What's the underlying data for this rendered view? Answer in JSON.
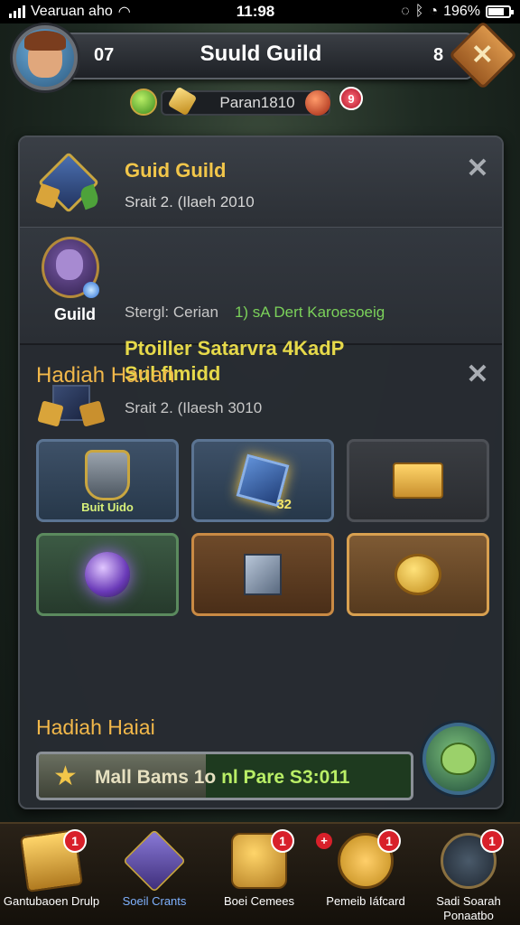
{
  "status_bar": {
    "carrier": "Vearuan aho",
    "time": "11:98",
    "battery": "196%"
  },
  "header": {
    "level": "07",
    "title": "Suuld Guild",
    "count": "8",
    "close_symbol": "✕",
    "currency_label": "Paran1810",
    "notification_badge": "9"
  },
  "guild_card": {
    "title": "Guid Guild",
    "subtitle": "Srait 2. (Ilaeh 2010",
    "close_symbol": "✕"
  },
  "member_card": {
    "label": "Guild",
    "title_line1": "Ptoiller Satarvra 4KadP",
    "title_line2": "Sul flmidd",
    "meta": "Stergl: Cerian",
    "meta_highlight": "1) sA Dert Karoesoeig"
  },
  "daily_rewards": {
    "title": "Hadiah Harian",
    "subtitle": "Srait 2. (Ilaesh 3010",
    "close_symbol": "✕",
    "items": [
      {
        "icon": "armor-icon",
        "label": "Buit  Uido",
        "count": "",
        "style": "blue"
      },
      {
        "icon": "crystal-cube-icon",
        "label": "",
        "count": "32",
        "style": "blue"
      },
      {
        "icon": "gold-box-icon",
        "label": "",
        "count": "",
        "style": "dark"
      },
      {
        "icon": "magic-orb-icon",
        "label": "",
        "count": "",
        "style": "green"
      },
      {
        "icon": "silver-cube-icon",
        "label": "",
        "count": "",
        "style": "brown"
      },
      {
        "icon": "gold-coins-icon",
        "label": "",
        "count": "",
        "style": "lbrown"
      }
    ]
  },
  "daily_bonus": {
    "title": "Hadiah Haiai",
    "progress_text": "Mall Bams 1o",
    "progress_highlight": "nl Pare S3:011",
    "progress_fraction": 0.45,
    "star_symbol": "★"
  },
  "bottom_nav": [
    {
      "label": "Gantubaoen Drulp",
      "icon": "gold-bricks-icon",
      "badge": "1",
      "active": false
    },
    {
      "label": "Soeil Crants",
      "icon": "hammer-icon",
      "badge": "",
      "active": true
    },
    {
      "label": "Boei Cemees",
      "icon": "treasure-chest-icon",
      "badge": "1",
      "active": false
    },
    {
      "label": "Pemeib Iáfcard",
      "icon": "heart-shield-icon",
      "badge": "1",
      "active": false
    },
    {
      "label": "Sadi Soarah Ponaatbo",
      "icon": "sword-icon",
      "badge": "1",
      "active": false
    }
  ],
  "colors": {
    "accent_gold": "#f2b84a",
    "accent_green": "#7bd15a",
    "badge_red": "#d8202a",
    "active_blue": "#7fb2ff"
  }
}
